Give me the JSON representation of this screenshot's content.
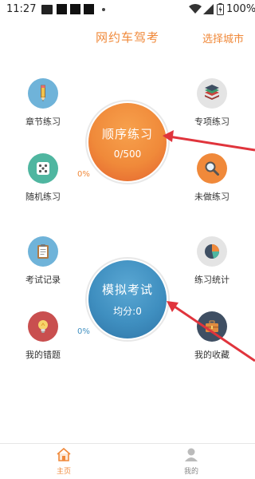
{
  "status_bar": {
    "time": "11:27",
    "battery": "100%"
  },
  "header": {
    "title": "网约车驾考",
    "city_link": "选择城市"
  },
  "left_items": [
    {
      "label": "章节练习",
      "icon": "pencil-icon"
    },
    {
      "label": "随机练习",
      "icon": "dice-icon"
    },
    {
      "label": "考试记录",
      "icon": "clipboard-icon"
    },
    {
      "label": "我的错题",
      "icon": "lightbulb-icon"
    }
  ],
  "right_items": [
    {
      "label": "专项练习",
      "icon": "layers-icon"
    },
    {
      "label": "未做练习",
      "icon": "magnifier-icon"
    },
    {
      "label": "练习统计",
      "icon": "pie-chart-icon"
    },
    {
      "label": "我的收藏",
      "icon": "briefcase-icon"
    }
  ],
  "practice": {
    "title": "顺序练习",
    "progress": "0/500",
    "percent": "0%",
    "color": "#f0893a"
  },
  "exam": {
    "title": "模拟考试",
    "score": "均分:0",
    "percent": "0%",
    "color": "#3f8fc0"
  },
  "bottom_nav": {
    "home": "主页",
    "mine": "我的",
    "active_color": "#f0893a"
  },
  "colors": {
    "accent": "#f0893a",
    "arrow": "#e0343c"
  }
}
